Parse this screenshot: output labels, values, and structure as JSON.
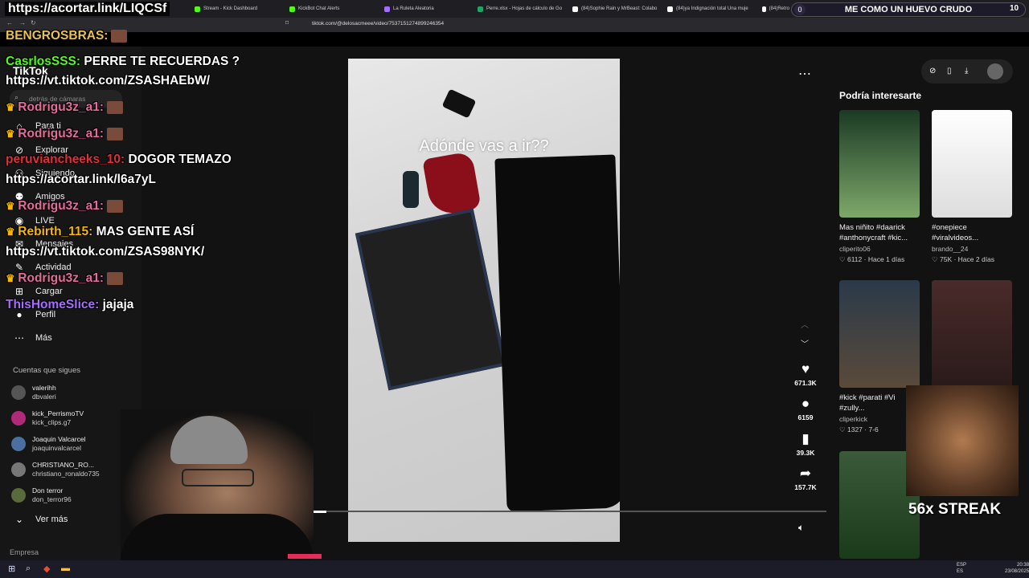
{
  "browser": {
    "tabs": [
      {
        "label": "Stream - Kick Dashboard",
        "color": "#53fc18"
      },
      {
        "label": "KickBot Chat Alerts",
        "color": "#53fc18"
      },
      {
        "label": "La Ruleta Aleatoria",
        "color": "#a66cff"
      },
      {
        "label": "Perre.xlsx - Hojas de cálculo de Go",
        "color": "#1fa463"
      },
      {
        "label": "(84)Sophie Rain y MrBeast: Colabo",
        "color": "#ffffff"
      },
      {
        "label": "(84)ya Indignación total Una muje",
        "color": "#ffffff"
      },
      {
        "label": "(84)Retro",
        "color": "#ffffff"
      }
    ],
    "url": "tiktok.com/@delosacmeee/video/7537151274899246354"
  },
  "stream_overlay": {
    "top_link": "https://acortar.link/LIQCSf",
    "goal": {
      "start": "0",
      "text": "ME COMO UN HUEVO CRUDO",
      "end": "10"
    },
    "streak": "56x STREAK"
  },
  "chat": [
    {
      "user": "BENGROSBRAS:",
      "text": "",
      "user_color": "#e8c14f",
      "crown": false
    },
    {
      "user": "CasrlosSSS:",
      "text": "PERRE TE RECUERDAS ?",
      "user_color": "#53fc18",
      "crown": false
    },
    {
      "user": "",
      "text": "https://vt.tiktok.com/ZSASHAEbW/",
      "user_color": "#ffffff",
      "crown": false
    },
    {
      "user": "Rodrigu3z_a1:",
      "text": "",
      "user_color": "#e76a9b",
      "crown": true
    },
    {
      "user": "Rodrigu3z_a1:",
      "text": "",
      "user_color": "#e76a9b",
      "crown": true
    },
    {
      "user": "peruviancheeks_10:",
      "text": "DOGOR TEMAZO",
      "user_color": "#e0303a",
      "crown": false
    },
    {
      "user": "",
      "text": "https://acortar.link/l6a7yL",
      "user_color": "#ffffff",
      "crown": false
    },
    {
      "user": "Rodrigu3z_a1:",
      "text": "",
      "user_color": "#e76a9b",
      "crown": true
    },
    {
      "user": "Rebirth_115:",
      "text": "MAS GENTE ASÍ",
      "user_color": "#f5b700",
      "crown": true
    },
    {
      "user": "",
      "text": "https://vt.tiktok.com/ZSAS98NYK/",
      "user_color": "#ffffff",
      "crown": false
    },
    {
      "user": "Rodrigu3z_a1:",
      "text": "",
      "user_color": "#e76a9b",
      "crown": true
    },
    {
      "user": "ThisHomeSlice:",
      "text": "jajaja",
      "user_color": "#a86cff",
      "crown": false
    }
  ],
  "tiktok": {
    "logo": "TikTok",
    "search_placeholder": "detrás de cámaras",
    "nav": [
      "Para ti",
      "Explorar",
      "Siguiendo",
      "Amigos",
      "LIVE",
      "Mensajes",
      "Actividad",
      "Cargar",
      "Perfil",
      "Más"
    ],
    "following_title": "Cuentas que sigues",
    "following": [
      {
        "name": "valerihh",
        "handle": "dbvaleri"
      },
      {
        "name": "kick_PerrismoTV",
        "handle": "kick_clips.g7"
      },
      {
        "name": "Joaquin Valcarcel",
        "handle": "joaquinvalcarcel"
      },
      {
        "name": "CHRISTIANO_RO...",
        "handle": "christiano_ronaldo735"
      },
      {
        "name": "Don terror",
        "handle": "don_terror96"
      }
    ],
    "see_more": "Ver más",
    "company": "Empresa",
    "video_caption": "Adónde vas a ir??",
    "actions": {
      "likes": "671.3K",
      "comments": "6159",
      "saves": "39.3K",
      "shares": "157.7K"
    },
    "recommend_title": "Podría interesarte",
    "recommended": [
      {
        "title": "Mas niñito #daarick #anthonycraft #kic...",
        "user": "cliperito06",
        "likes": "6112",
        "time": "Hace 1 días"
      },
      {
        "title": "#onepiece #viralvideos...",
        "user": "brando__24",
        "likes": "75K",
        "time": "Hace 2 días"
      },
      {
        "title": "#kick #parati #Vi #zully...",
        "user": "cliperkick",
        "likes": "1327",
        "time": "7-6"
      }
    ]
  },
  "taskbar": {
    "lang": "ESP\nES",
    "time": "20:38",
    "date": "23/08/2025"
  }
}
